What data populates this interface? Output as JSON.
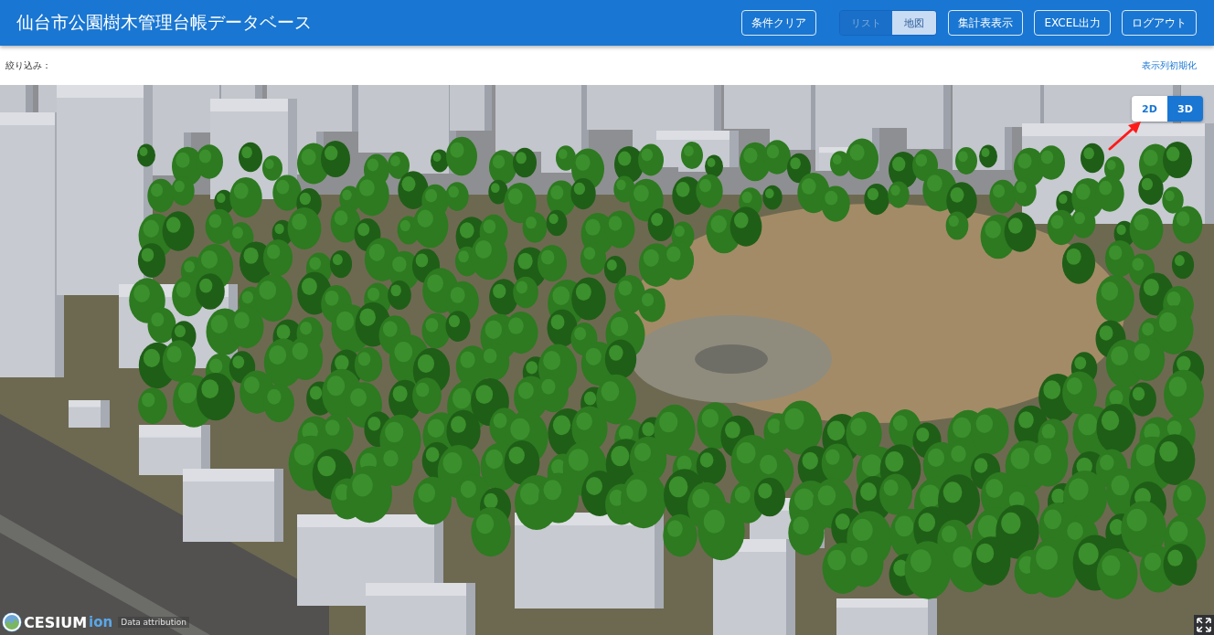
{
  "header": {
    "title": "仙台市公園樹木管理台帳データベース",
    "actions": [
      {
        "kind": "button",
        "label": "条件クリア"
      },
      {
        "kind": "toggle",
        "options": [
          {
            "label": "リスト",
            "selected": false
          },
          {
            "label": "地図",
            "selected": true
          }
        ]
      },
      {
        "kind": "button",
        "label": "集計表表示"
      },
      {
        "kind": "button",
        "label": "EXCEL出力"
      },
      {
        "kind": "button",
        "label": "ログアウト"
      }
    ]
  },
  "filter_bar": {
    "label": "絞り込み：",
    "reset_link": "表示列初期化"
  },
  "map": {
    "mode_toggle": [
      {
        "label": "2D",
        "selected": false
      },
      {
        "label": "3D",
        "selected": true
      }
    ],
    "logo": {
      "wordmark": "CESIUM",
      "suffix": "ion"
    },
    "attribution_link": "Data attribution"
  }
}
